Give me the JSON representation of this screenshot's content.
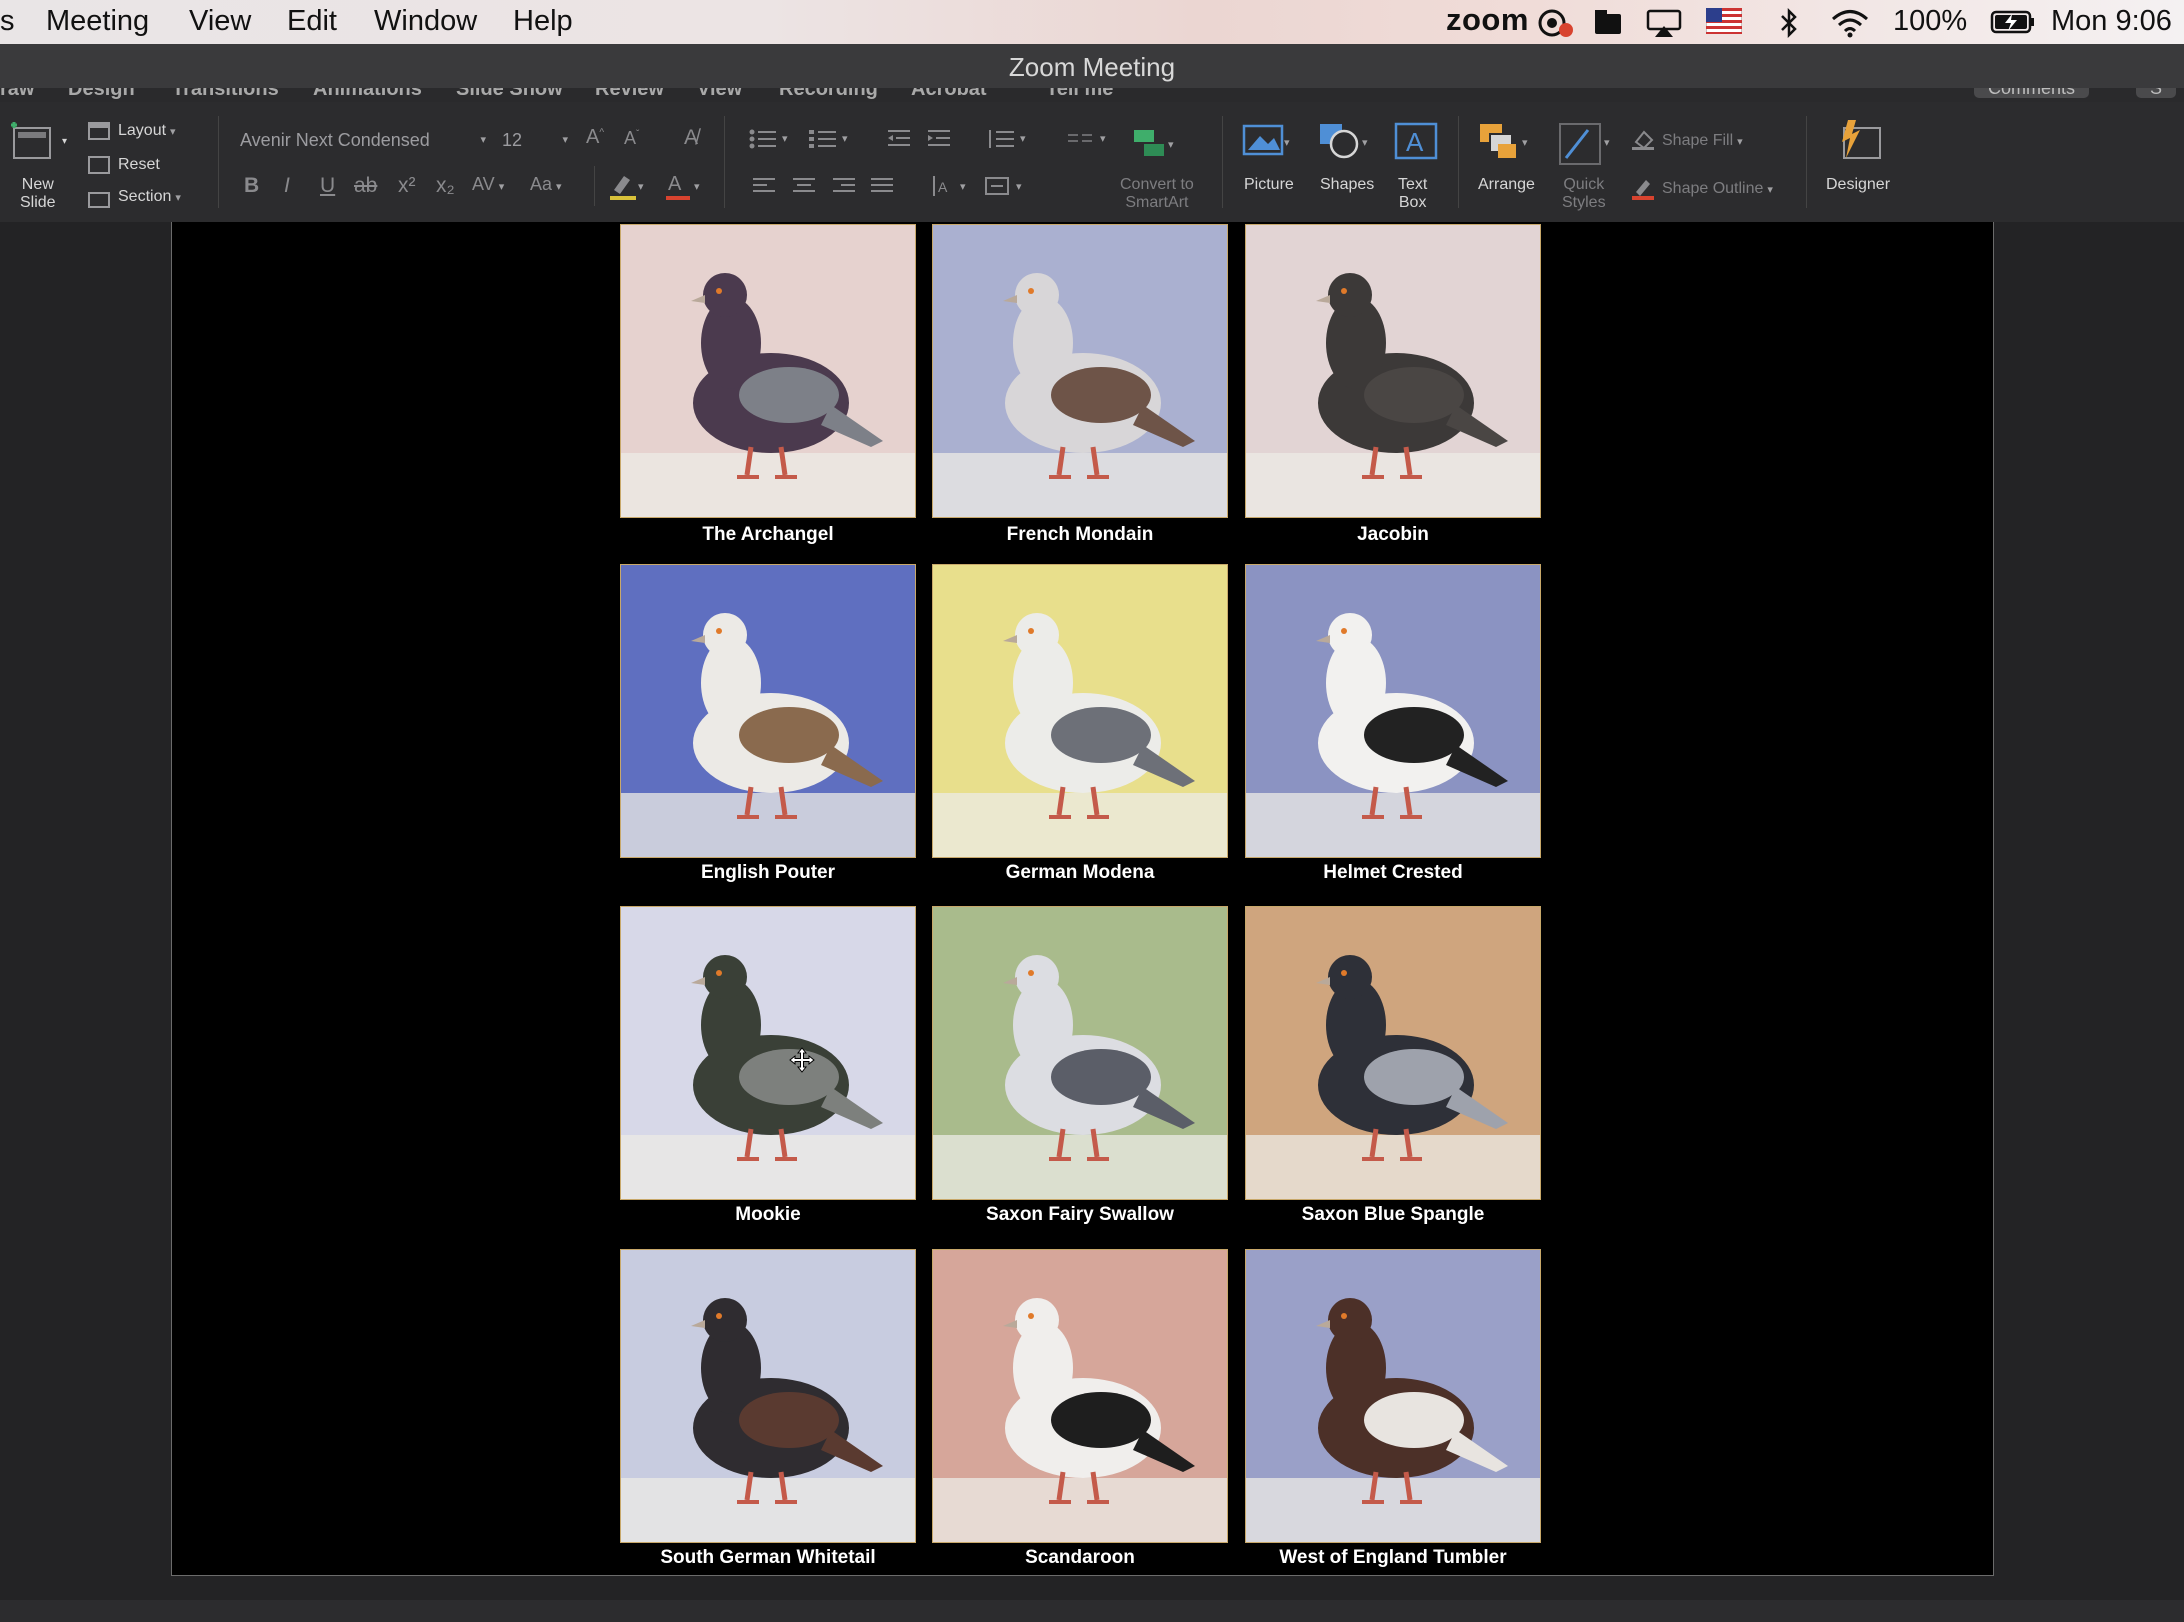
{
  "menubar": {
    "app_fragment": "s",
    "items": [
      "Meeting",
      "View",
      "Edit",
      "Window",
      "Help"
    ],
    "zoom_logo": "zoom",
    "battery": "100%",
    "clock": "Mon 9:06"
  },
  "window": {
    "title": "Zoom Meeting"
  },
  "ribbon_tabs": [
    "raw",
    "Design",
    "Transitions",
    "Animations",
    "Slide Show",
    "Review",
    "View",
    "Recording",
    "Acrobat",
    "Tell me"
  ],
  "ribbon_right": {
    "comments": "Comments",
    "share": "S"
  },
  "ribbon": {
    "new_slide": [
      "New",
      "Slide"
    ],
    "layout": "Layout",
    "reset": "Reset",
    "section": "Section",
    "font_name": "Avenir Next Condensed",
    "font_size": "12",
    "bold": "B",
    "italic": "I",
    "underline": "U",
    "strike": "ab",
    "superscript": "x²",
    "subscript": "x₂",
    "spacing": "AV",
    "change_case": "Aa",
    "convert_smartart": [
      "Convert to",
      "SmartArt"
    ],
    "picture": "Picture",
    "shapes": "Shapes",
    "text_box": [
      "Text",
      "Box"
    ],
    "arrange": "Arrange",
    "quick_styles": [
      "Quick",
      "Styles"
    ],
    "shape_fill": "Shape Fill",
    "shape_outline": "Shape Outline",
    "designer": "Designer"
  },
  "slide": {
    "pigeons": [
      {
        "name": "The Archangel",
        "bg": "#e6d2cf",
        "body": "#4b3a4e",
        "wing": "#7d8088"
      },
      {
        "name": "French Mondain",
        "bg": "#aab0d0",
        "body": "#d8d6d8",
        "wing": "#6e5448"
      },
      {
        "name": "Jacobin",
        "bg": "#e2d4d4",
        "body": "#3c3938",
        "wing": "#4a4644"
      },
      {
        "name": "English Pouter",
        "bg": "#5f6fc0",
        "body": "#eceae6",
        "wing": "#8a6a4e"
      },
      {
        "name": "German Modena",
        "bg": "#e8df8c",
        "body": "#ecece9",
        "wing": "#6d7078"
      },
      {
        "name": "Helmet Crested",
        "bg": "#8b93c2",
        "body": "#f2f1ef",
        "wing": "#222222"
      },
      {
        "name": "Mookie",
        "bg": "#d7d8e8",
        "body": "#3a4037",
        "wing": "#7d807d"
      },
      {
        "name": "Saxon Fairy Swallow",
        "bg": "#a9bb8c",
        "body": "#dcdde2",
        "wing": "#5b5e68"
      },
      {
        "name": "Saxon Blue Spangle",
        "bg": "#cfa57e",
        "body": "#2e3038",
        "wing": "#9ea2ac"
      },
      {
        "name": "South German Whitetail",
        "bg": "#c8cce0",
        "body": "#2f2c30",
        "wing": "#5a3a30"
      },
      {
        "name": "Scandaroon",
        "bg": "#d6a69a",
        "body": "#f0eeec",
        "wing": "#1e1e1e"
      },
      {
        "name": "West of England Tumbler",
        "bg": "#9aa0c8",
        "body": "#4c3028",
        "wing": "#e8e4e0"
      }
    ]
  }
}
